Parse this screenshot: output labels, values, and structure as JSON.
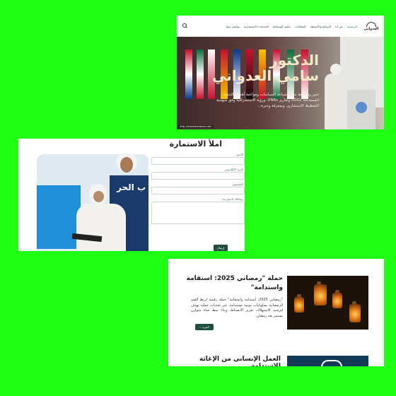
{
  "header": {
    "logo_text": "العدواني",
    "menu": [
      "الرئيسية",
      "من أنا",
      "البرامج والأنشطة",
      "الفعاليات",
      "مكتبة الوسائط",
      "الخدمات الاستشارية",
      "تواصل معنا"
    ]
  },
  "hero": {
    "title_line1": "الدكتور",
    "title_line2": "سامي العدواني",
    "description": "خبير ومخطط ملهم بصياغة السياسات ومواءمة أهداف التنمية المستدامة SDGs وتقارير VNRs، ورؤية الاستشرافية وفق منهجية التخطيط الاستشاري، وبمعرفة وخبرة...",
    "caption": "http://sameialadwani.com"
  },
  "form": {
    "title": "املأ الاستمارة",
    "fields": [
      {
        "label": "الاسم"
      },
      {
        "label": "البريد الإلكتروني"
      },
      {
        "label": "الموضوع"
      }
    ],
    "textarea_label": "رسالتك (اختيارية)",
    "submit_label": "إرسال",
    "photo_banner_text": "ب الحر"
  },
  "news": {
    "items": [
      {
        "title": "حملة \"رمضاني 2025: استقامة واستدامة\"",
        "body": "\"رمضاني 2025: استدامة واستقامة\" حملة رقمية لربط القيم الرمضانية بسلوكيات يومية مستدامة، عبر تحديات عملية تهدف لترشيد الاستهلاك، تعزيز الانضباط، وبناء نمط حياة متوازن يستمر بعد رمضان.",
        "more_label": "المزيد"
      },
      {
        "title": "العمل الإنساني من الإغاثة للاستدامة"
      }
    ]
  },
  "colors": {
    "background": "#1fff14",
    "accent": "#1f4f3d",
    "hero_title": "#f4e8c7"
  }
}
